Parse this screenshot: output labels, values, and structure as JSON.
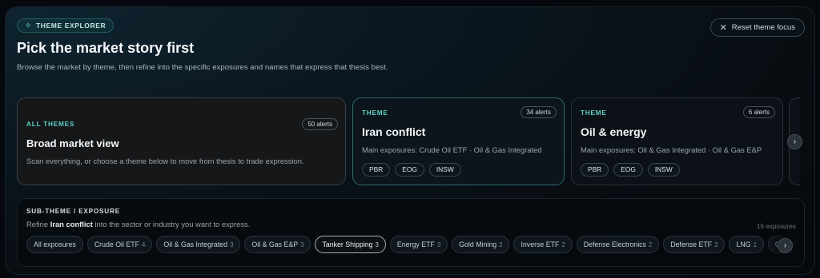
{
  "header": {
    "tag_label": "THEME EXPLORER",
    "title": "Pick the market story first",
    "subtitle": "Browse the market by theme, then refine into the specific exposures and names that express that thesis best.",
    "reset_label": "Reset theme focus"
  },
  "themes": [
    {
      "kicker": "ALL THEMES",
      "count": "50 alerts",
      "name": "Broad market view",
      "desc": "Scan everything, or choose a theme below to move from thesis to trade expression.",
      "tickers": []
    },
    {
      "kicker": "THEME",
      "count": "34 alerts",
      "name": "Iran conflict",
      "desc": "Main exposures: Crude Oil ETF · Oil & Gas Integrated",
      "tickers": [
        "PBR",
        "EOG",
        "INSW"
      ]
    },
    {
      "kicker": "THEME",
      "count": "6 alerts",
      "name": "Oil & energy",
      "desc": "Main exposures: Oil & Gas Integrated · Oil & Gas E&P",
      "tickers": [
        "PBR",
        "EOG",
        "INSW"
      ]
    }
  ],
  "subtheme": {
    "kicker": "SUB-THEME / EXPOSURE",
    "desc_prefix": "Refine ",
    "desc_focus": "Iran conflict",
    "desc_suffix": " into the sector or industry you want to express.",
    "count": "19 exposures",
    "chips": [
      {
        "label": "All exposures",
        "n": ""
      },
      {
        "label": "Crude Oil ETF",
        "n": "4"
      },
      {
        "label": "Oil & Gas Integrated",
        "n": "3"
      },
      {
        "label": "Oil & Gas E&P",
        "n": "3"
      },
      {
        "label": "Tanker Shipping",
        "n": "3"
      },
      {
        "label": "Energy ETF",
        "n": "3"
      },
      {
        "label": "Gold Mining",
        "n": "2"
      },
      {
        "label": "Inverse ETF",
        "n": "2"
      },
      {
        "label": "Defense Electronics",
        "n": "2"
      },
      {
        "label": "Defense ETF",
        "n": "2"
      },
      {
        "label": "LNG",
        "n": "1"
      },
      {
        "label": "Cybe",
        "n": ""
      }
    ],
    "active_chip": "Tanker Shipping"
  },
  "icons": {
    "tag_icon": "sparkle-icon",
    "reset_icon": "close-icon",
    "scroll_icon": "chevron-right-icon"
  },
  "colors": {
    "accent": "#5fd3c8",
    "selected_card_border": "#2c6a70"
  }
}
